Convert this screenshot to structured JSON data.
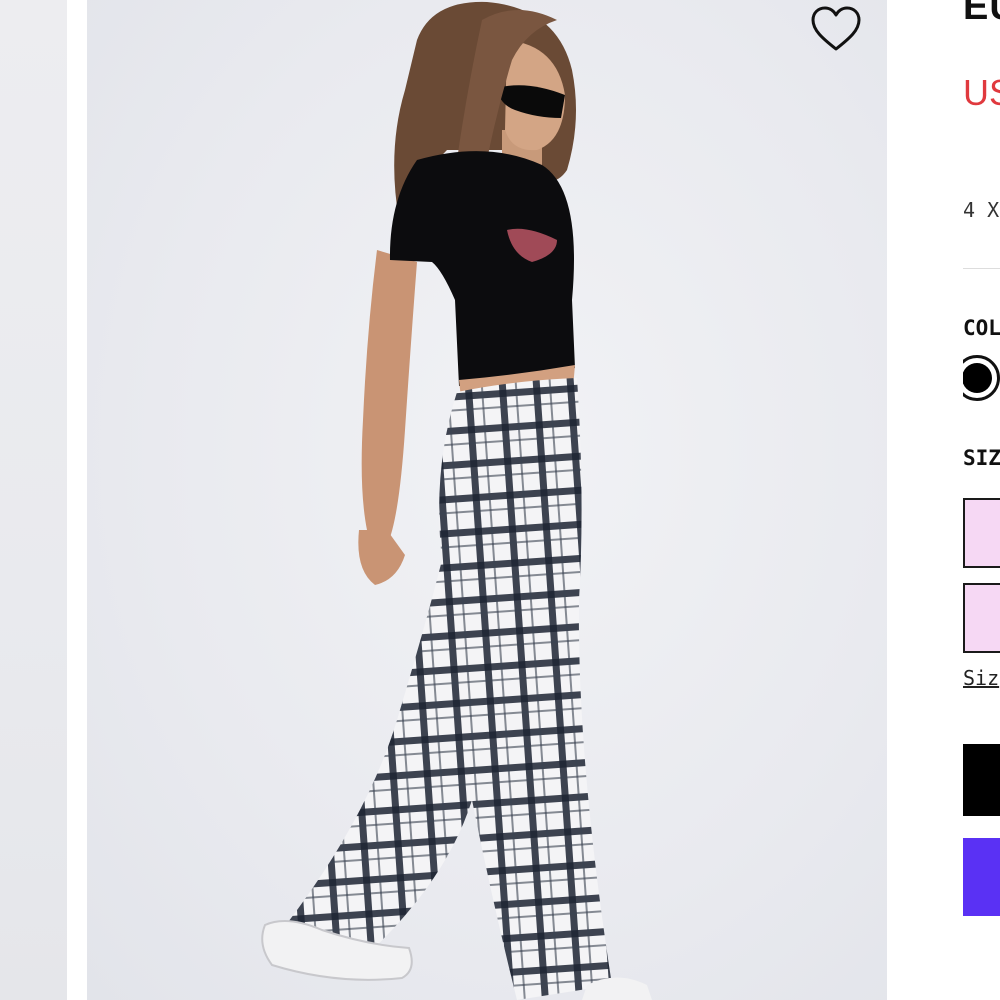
{
  "gallery": {
    "main_image": "model-wearing-check-pants",
    "wishlist_icon": "heart-outline-icon"
  },
  "product": {
    "title_partial": "EU",
    "price_partial": "US",
    "installments_partial": "4 X",
    "colour_label_partial": "COL",
    "selected_colour": "#000000",
    "size_label_partial": "SIZ",
    "size_guide_partial": "Siz",
    "colors": {
      "price": "#e0393e",
      "size_option_bg": "#f6d8f4",
      "add_to_bag_bg": "#000000",
      "express_pay_bg": "#5a31f4"
    }
  }
}
